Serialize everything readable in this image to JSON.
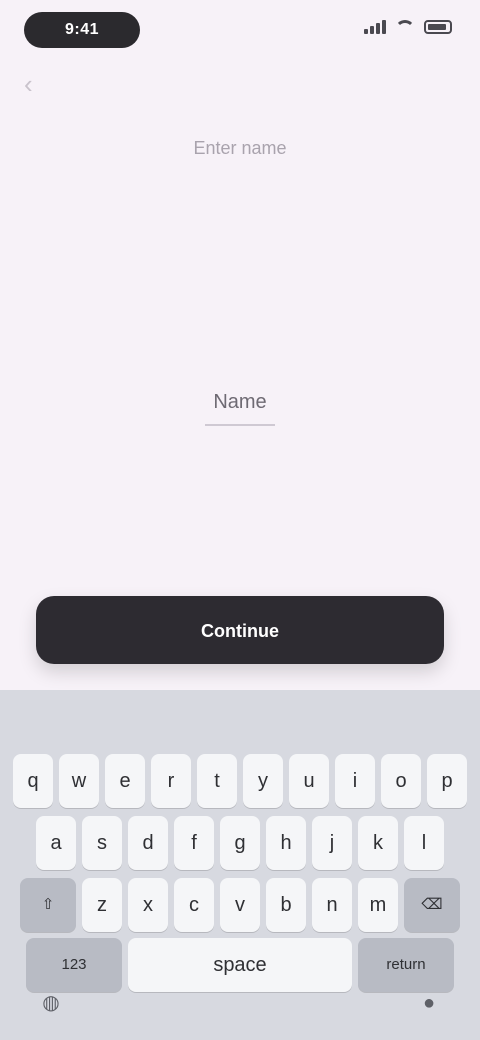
{
  "status_bar": {
    "pill_text": "9:41"
  },
  "page": {
    "title": "Enter name",
    "field_text": "Name",
    "primary_button": "Continue"
  },
  "keyboard": {
    "suggestions": [
      "",
      "",
      ""
    ],
    "row1": [
      "q",
      "w",
      "e",
      "r",
      "t",
      "y",
      "u",
      "i",
      "o",
      "p"
    ],
    "row2": [
      "a",
      "s",
      "d",
      "f",
      "g",
      "h",
      "j",
      "k",
      "l"
    ],
    "row3_left": "⇧",
    "row3": [
      "z",
      "x",
      "c",
      "v",
      "b",
      "n",
      "m"
    ],
    "row3_right": "⌫",
    "row4_left": "123",
    "row4_space": "space",
    "row4_return": "return"
  },
  "icons": {
    "back": "chevron-left-icon",
    "globe": "globe-icon",
    "mic": "mic-icon"
  }
}
